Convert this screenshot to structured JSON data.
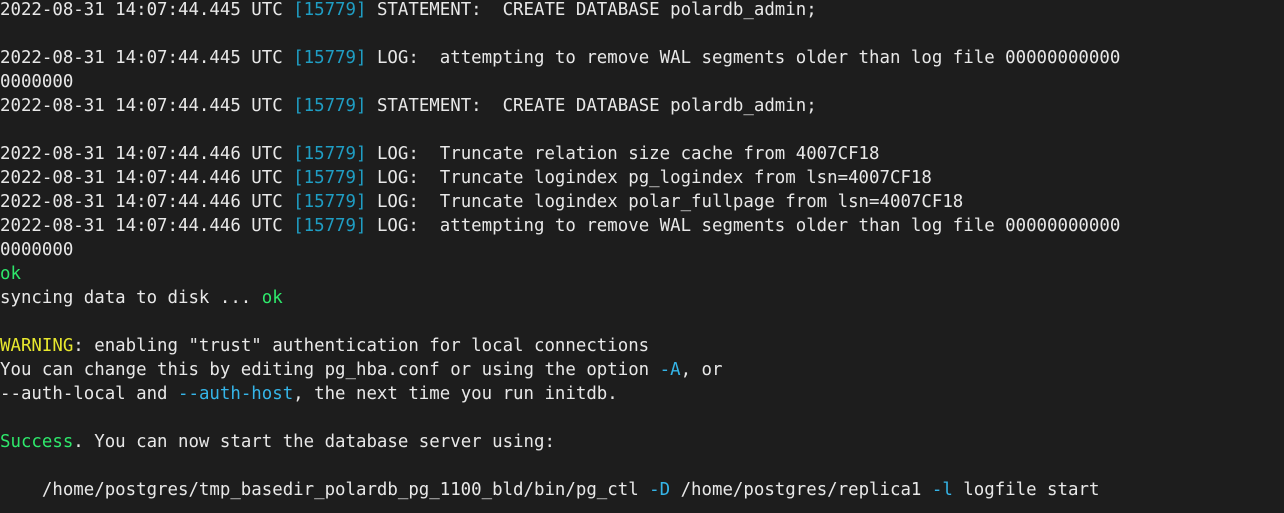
{
  "terminal": {
    "title": "Terminal Output",
    "background_color": "#1d1d1d",
    "foreground_color": "#e8e8e8",
    "pid_color": "#1f9ec4",
    "flag_color": "#35b5e8",
    "success_color": "#2ee86b",
    "warning_color": "#e8e82e",
    "columns": 104,
    "rows": 21,
    "font_size_px": 17.4,
    "line_height_px": 24
  },
  "lines": [
    {
      "id": "line-1-statement-create-database",
      "segments": [
        {
          "text": "2022-08-31 14:07:44.445 UTC ",
          "color": "default"
        },
        {
          "text": "[15779]",
          "color": "pid"
        },
        {
          "text": " STATEMENT:  CREATE DATABASE polardb_admin;",
          "color": "default"
        }
      ]
    },
    {
      "id": "line-2-blank",
      "segments": [
        {
          "text": "",
          "color": "default"
        }
      ]
    },
    {
      "id": "line-3-log-attempting-remove-wal",
      "segments": [
        {
          "text": "2022-08-31 14:07:44.445 UTC ",
          "color": "default"
        },
        {
          "text": "[15779]",
          "color": "pid"
        },
        {
          "text": " LOG:  attempting to remove WAL segments older than log file 00000000000",
          "color": "default"
        }
      ]
    },
    {
      "id": "line-4-wal-filename-wrap",
      "segments": [
        {
          "text": "0000000",
          "color": "default"
        }
      ]
    },
    {
      "id": "line-5-statement-create-database",
      "segments": [
        {
          "text": "2022-08-31 14:07:44.445 UTC ",
          "color": "default"
        },
        {
          "text": "[15779]",
          "color": "pid"
        },
        {
          "text": " STATEMENT:  CREATE DATABASE polardb_admin;",
          "color": "default"
        }
      ]
    },
    {
      "id": "line-6-blank",
      "segments": [
        {
          "text": "",
          "color": "default"
        }
      ]
    },
    {
      "id": "line-7-truncate-relation-size-cache",
      "segments": [
        {
          "text": "2022-08-31 14:07:44.446 UTC ",
          "color": "default"
        },
        {
          "text": "[15779]",
          "color": "pid"
        },
        {
          "text": " LOG:  Truncate relation size cache from 4007CF18",
          "color": "default"
        }
      ]
    },
    {
      "id": "line-8-truncate-logindex-pg-logindex",
      "segments": [
        {
          "text": "2022-08-31 14:07:44.446 UTC ",
          "color": "default"
        },
        {
          "text": "[15779]",
          "color": "pid"
        },
        {
          "text": " LOG:  Truncate logindex pg_logindex from lsn=4007CF18",
          "color": "default"
        }
      ]
    },
    {
      "id": "line-9-truncate-logindex-polar-fullpage",
      "segments": [
        {
          "text": "2022-08-31 14:07:44.446 UTC ",
          "color": "default"
        },
        {
          "text": "[15779]",
          "color": "pid"
        },
        {
          "text": " LOG:  Truncate logindex polar_fullpage from lsn=4007CF18",
          "color": "default"
        }
      ]
    },
    {
      "id": "line-10-log-attempting-remove-wal",
      "segments": [
        {
          "text": "2022-08-31 14:07:44.446 UTC ",
          "color": "default"
        },
        {
          "text": "[15779]",
          "color": "pid"
        },
        {
          "text": " LOG:  attempting to remove WAL segments older than log file 00000000000",
          "color": "default"
        }
      ]
    },
    {
      "id": "line-11-wal-filename-wrap",
      "segments": [
        {
          "text": "0000000",
          "color": "default"
        }
      ]
    },
    {
      "id": "line-12-ok",
      "segments": [
        {
          "text": "ok",
          "color": "green"
        }
      ]
    },
    {
      "id": "line-13-syncing-data-to-disk",
      "segments": [
        {
          "text": "syncing data to disk ... ",
          "color": "default"
        },
        {
          "text": "ok",
          "color": "green"
        }
      ]
    },
    {
      "id": "line-14-blank",
      "segments": [
        {
          "text": "",
          "color": "default"
        }
      ]
    },
    {
      "id": "line-15-warning-trust-authentication",
      "segments": [
        {
          "text": "WARNING",
          "color": "yellow"
        },
        {
          "text": ": enabling \"trust\" authentication for local connections",
          "color": "default"
        }
      ]
    },
    {
      "id": "line-16-change-pg-hba-conf",
      "segments": [
        {
          "text": "You can change this by editing pg_hba.conf or using the option ",
          "color": "default"
        },
        {
          "text": "-A",
          "color": "flag"
        },
        {
          "text": ", or",
          "color": "default"
        }
      ]
    },
    {
      "id": "line-17-auth-local-auth-host",
      "segments": [
        {
          "text": "--auth-local and ",
          "color": "default"
        },
        {
          "text": "--auth-host",
          "color": "flag"
        },
        {
          "text": ", the next time you run initdb.",
          "color": "default"
        }
      ]
    },
    {
      "id": "line-18-blank",
      "segments": [
        {
          "text": "",
          "color": "default"
        }
      ]
    },
    {
      "id": "line-19-success-start-server",
      "segments": [
        {
          "text": "Success",
          "color": "green"
        },
        {
          "text": ". You can now start the database server using:",
          "color": "default"
        }
      ]
    },
    {
      "id": "line-20-blank",
      "segments": [
        {
          "text": "",
          "color": "default"
        }
      ]
    },
    {
      "id": "line-21-pg-ctl-command",
      "segments": [
        {
          "text": "    /home/postgres/tmp_basedir_polardb_pg_1100_bld/bin/pg_ctl ",
          "color": "default"
        },
        {
          "text": "-D",
          "color": "flag"
        },
        {
          "text": " /home/postgres/replica1 ",
          "color": "default"
        },
        {
          "text": "-l",
          "color": "flag"
        },
        {
          "text": " logfile start",
          "color": "default"
        }
      ]
    }
  ]
}
